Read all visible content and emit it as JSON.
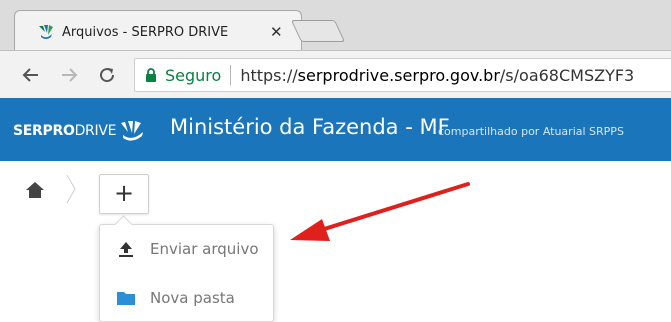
{
  "browser": {
    "tab": {
      "title": "Arquivos - SERPRO DRIVE",
      "close_icon": "close-icon",
      "favicon": "serprodrive-favicon"
    },
    "nav": {
      "back_icon": "back-arrow-icon",
      "forward_icon": "forward-arrow-icon",
      "reload_icon": "reload-icon"
    },
    "address": {
      "secure_label": "Seguro",
      "url_scheme": "https://",
      "url_host": "serprodrive.serpro.gov.br",
      "url_path": "/s/oa68CMSZYF3",
      "lock_icon": "lock-icon"
    }
  },
  "app": {
    "logo_bold": "SERPRO",
    "logo_light": "DRIVE",
    "title": "Ministério da Fazenda - MF",
    "subtitle": "compartilhado por Atuarial SRPPS",
    "brand_color": "#1b75bb"
  },
  "breadcrumb": {
    "home_icon": "home-icon",
    "separator_icon": "chevron-right-icon"
  },
  "new_menu": {
    "button_label": "+",
    "items": [
      {
        "label": "Enviar arquivo",
        "icon": "upload-icon"
      },
      {
        "label": "Nova pasta",
        "icon": "folder-icon"
      }
    ]
  },
  "annotation": {
    "arrow_color": "#e0201c",
    "arrow_icon": "red-arrow-annotation"
  }
}
